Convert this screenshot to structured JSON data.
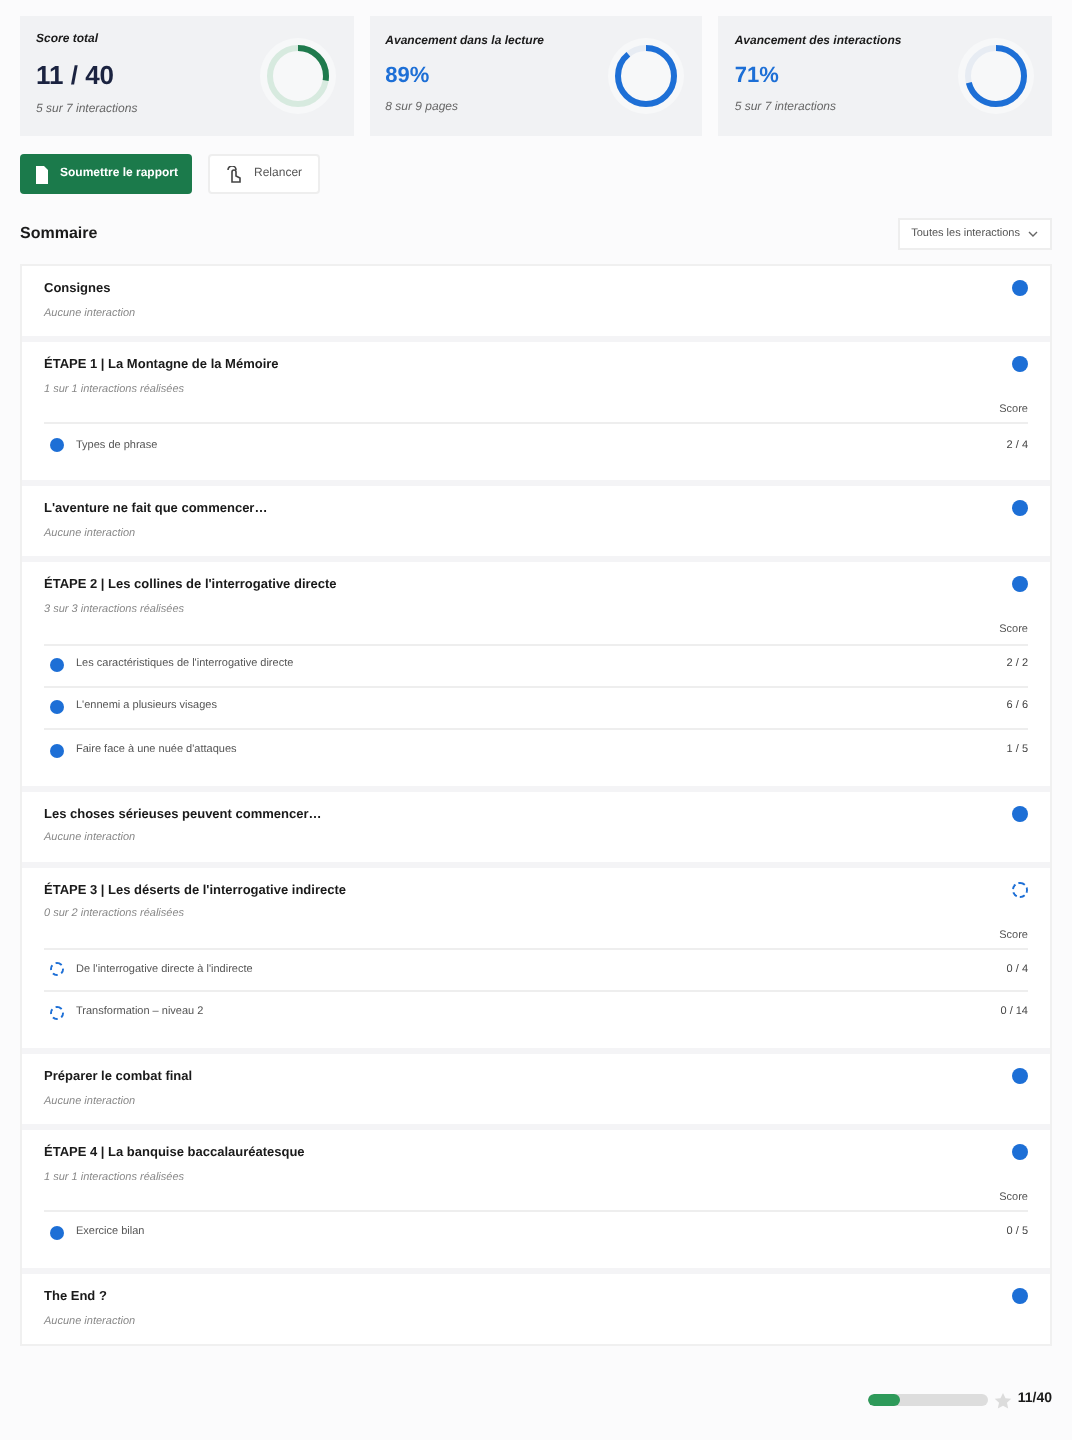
{
  "stats": [
    {
      "label": "Score total",
      "value": "11 / 40",
      "caption": "5 sur 7 interactions",
      "level": 0.275,
      "kind": "score"
    },
    {
      "label": "Avancement dans la lecture",
      "value": "89%",
      "caption": "8 sur 9 pages",
      "level": 0.89,
      "kind": "progress"
    },
    {
      "label": "Avancement des interactions",
      "value": "71%",
      "caption": "5 sur 7 interactions",
      "level": 0.71,
      "kind": "progress"
    }
  ],
  "actions": {
    "submit": "Soumettre le rapport",
    "restart": "Relancer"
  },
  "summary": {
    "title": "Sommaire",
    "filter": "Toutes les interactions"
  },
  "sections": [
    {
      "title": "Consignes",
      "subtitle": "Aucune interaction",
      "complete": true
    },
    {
      "title": "ÉTAPE 1 | La Montagne de la Mémoire",
      "subtitle": "1 sur 1 interactions réalisées",
      "complete": true,
      "score_header": "Score",
      "items": [
        {
          "name": "Types de phrase",
          "score": "2 / 4",
          "complete": true
        }
      ]
    },
    {
      "title": "L'aventure ne fait que commencer…",
      "subtitle": "Aucune interaction",
      "complete": true
    },
    {
      "title": "ÉTAPE 2 | Les collines de l'interrogative directe",
      "subtitle": "3 sur 3 interactions réalisées",
      "complete": true,
      "score_header": "Score",
      "items": [
        {
          "name": "Les caractéristiques de l'interrogative directe",
          "score": "2 / 2",
          "complete": true
        },
        {
          "name": "L'ennemi a plusieurs visages",
          "score": "6 / 6",
          "complete": true
        },
        {
          "name": "Faire face à une nuée d'attaques",
          "score": "1 / 5",
          "complete": true
        }
      ]
    },
    {
      "title": "Les choses sérieuses peuvent commencer…",
      "subtitle": "Aucune interaction",
      "complete": true
    },
    {
      "title": "ÉTAPE 3 | Les déserts de l'interrogative indirecte",
      "subtitle": "0 sur 2 interactions réalisées",
      "complete": false,
      "score_header": "Score",
      "items": [
        {
          "name": "De l'interrogative directe à l'indirecte",
          "score": "0 / 4",
          "complete": false
        },
        {
          "name": "Transformation – niveau 2",
          "score": "0 / 14",
          "complete": false
        }
      ]
    },
    {
      "title": "Préparer le combat final",
      "subtitle": "Aucune interaction",
      "complete": true
    },
    {
      "title": "ÉTAPE 4 | La banquise baccalauréatesque",
      "subtitle": "1 sur 1 interactions réalisées",
      "complete": true,
      "score_header": "Score",
      "items": [
        {
          "name": "Exercice bilan",
          "score": "0 / 5",
          "complete": true
        }
      ]
    },
    {
      "title": "The End ?",
      "subtitle": "Aucune interaction",
      "complete": true
    }
  ],
  "footer": {
    "level": 0.275,
    "score": "11/40"
  }
}
